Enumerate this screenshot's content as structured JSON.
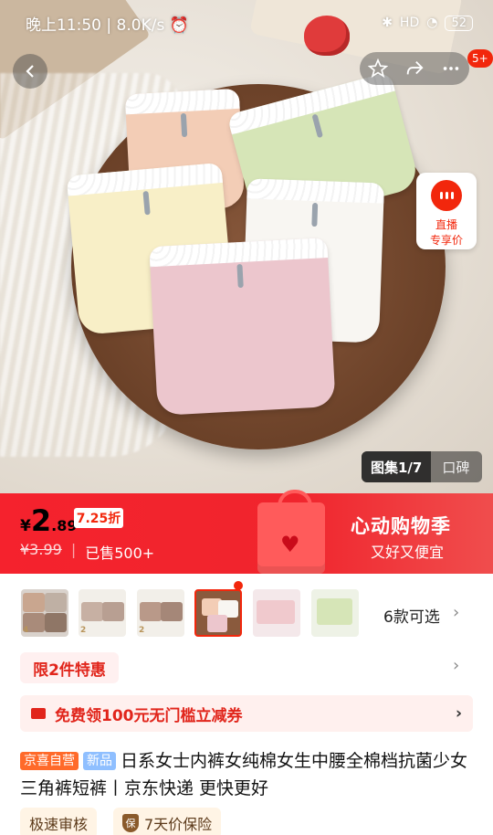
{
  "status_bar": {
    "time": "晚上11:50",
    "speed": "8.0K/s",
    "network": "HD",
    "battery": "52"
  },
  "header": {
    "badge": "5+"
  },
  "live": {
    "line1": "直播",
    "line2": "专享价"
  },
  "gallery": {
    "images": "图集1/7",
    "reviews": "口碑"
  },
  "price": {
    "currency": "¥",
    "integer": "2",
    "decimal": ".89",
    "discount": "7.25折",
    "original": "¥3.99",
    "sold": "已售500+"
  },
  "promo_banner": {
    "title": "心动购物季",
    "subtitle": "又好又便宜"
  },
  "variants": {
    "count_label": "6款可选",
    "thumbs": [
      {
        "num": "4"
      },
      {
        "num": "2"
      },
      {
        "num": "2"
      },
      {
        "num": ""
      },
      {
        "num": ""
      },
      {
        "num": ""
      }
    ]
  },
  "limit_offer": "限2件特惠",
  "coupon": "免费领100元无门槛立减券",
  "product": {
    "tag_self": "京喜自营",
    "tag_new": "新品",
    "title": "日系女士内裤女纯棉女生中腰全棉档抗菌少女三角裤短裤丨京东快递 更快更好"
  },
  "chips": {
    "review": "极速审核",
    "insurance": "7天价保险",
    "insurance_icon": "保"
  },
  "colors": {
    "accent": "#f2270c",
    "banner": "#f5222d"
  }
}
